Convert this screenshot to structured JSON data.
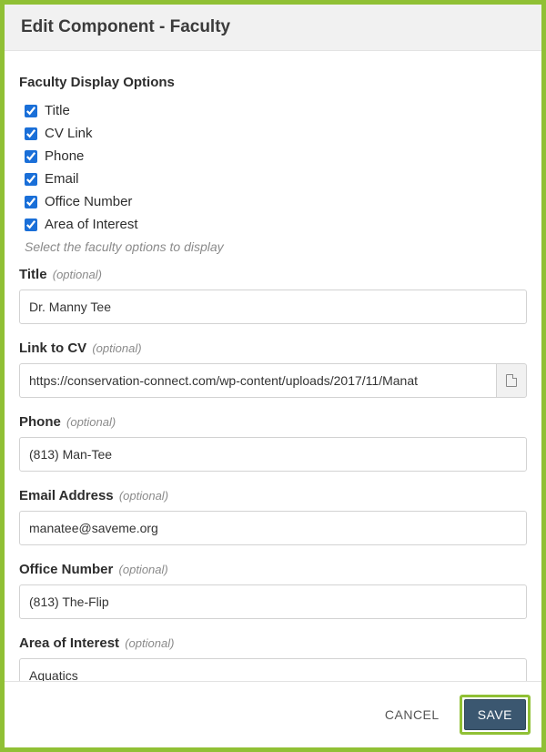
{
  "dialog": {
    "title": "Edit Component - Faculty"
  },
  "section": {
    "heading": "Faculty Display Options",
    "hint": "Select the faculty options to display"
  },
  "options": [
    {
      "label": "Title",
      "checked": true
    },
    {
      "label": "CV Link",
      "checked": true
    },
    {
      "label": "Phone",
      "checked": true
    },
    {
      "label": "Email",
      "checked": true
    },
    {
      "label": "Office Number",
      "checked": true
    },
    {
      "label": "Area of Interest",
      "checked": true
    }
  ],
  "optional_token": "(optional)",
  "fields": {
    "title": {
      "label": "Title",
      "value": "Dr. Manny Tee"
    },
    "cv": {
      "label": "Link to CV",
      "value": "https://conservation-connect.com/wp-content/uploads/2017/11/Manat"
    },
    "phone": {
      "label": "Phone",
      "value": "(813) Man-Tee"
    },
    "email": {
      "label": "Email Address",
      "value": "manatee@saveme.org"
    },
    "office": {
      "label": "Office Number",
      "value": "(813) The-Flip"
    },
    "aoi": {
      "label": "Area of Interest",
      "value": "Aquatics"
    }
  },
  "buttons": {
    "cancel": "CANCEL",
    "save": "SAVE"
  }
}
